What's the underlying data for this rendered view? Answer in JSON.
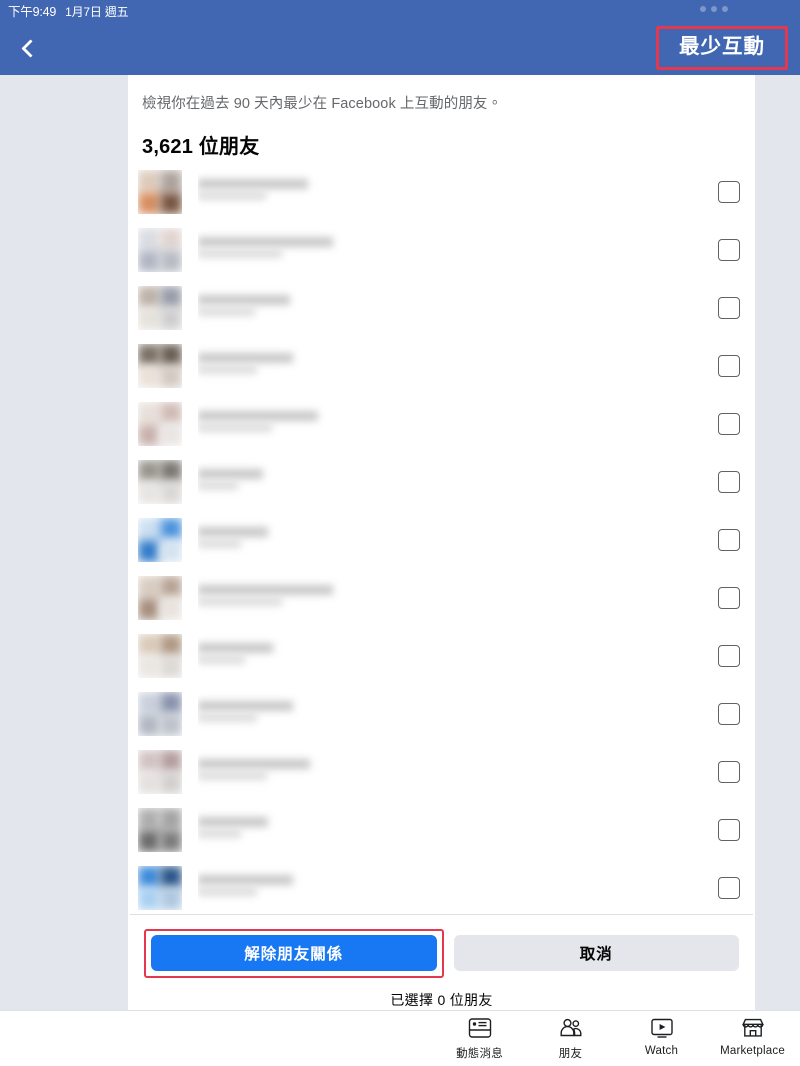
{
  "statusbar": {
    "time": "下午9:49",
    "date": "1月7日 週五",
    "menu_icon": "three-dots-icon"
  },
  "navbar": {
    "back_icon": "chevron-left-icon",
    "title": "最少互動",
    "title_highlight_color": "#e4384f",
    "background_color": "#4267B2"
  },
  "main": {
    "description": "檢視你在過去 90 天內最少在 Facebook 上互動的朋友。",
    "friend_count_label": "3,621 位朋友",
    "friends": [
      {
        "name": "",
        "avatar_colors": [
          "#d8c6b4",
          "#a59a94",
          "#d2824e",
          "#6b4630"
        ],
        "name_width": 110,
        "avatar_blurred": true
      },
      {
        "name": "",
        "avatar_colors": [
          "#d5d8df",
          "#ddd0cb",
          "#a9aebd",
          "#b0b4bd"
        ],
        "name_width": 135,
        "avatar_blurred": true
      },
      {
        "name": "",
        "avatar_colors": [
          "#b7a99f",
          "#8e93a0",
          "#e3ded8",
          "#c9c9c9"
        ],
        "name_width": 92,
        "avatar_blurred": true
      },
      {
        "name": "",
        "avatar_colors": [
          "#6e6256",
          "#5c4f43",
          "#e9ded4",
          "#cfc4bb"
        ],
        "name_width": 95,
        "avatar_blurred": true
      },
      {
        "name": "",
        "avatar_colors": [
          "#e5dcd5",
          "#cbb4ae",
          "#c3a9a4",
          "#e6e2e0"
        ],
        "name_width": 120,
        "avatar_blurred": true
      },
      {
        "name": "",
        "avatar_colors": [
          "#8e8a82",
          "#6e6a63",
          "#e4e2de",
          "#d6d4d1"
        ],
        "name_width": 65,
        "avatar_blurred": true
      },
      {
        "name": "",
        "avatar_colors": [
          "#c6dcef",
          "#3b88d8",
          "#1f6fc4",
          "#cfe0ee"
        ],
        "name_width": 70,
        "avatar_blurred": true
      },
      {
        "name": "",
        "avatar_colors": [
          "#d5c7ba",
          "#b09a8b",
          "#9d8371",
          "#e6e0da"
        ],
        "name_width": 135,
        "avatar_blurred": true
      },
      {
        "name": "",
        "avatar_colors": [
          "#d6c4b2",
          "#a88f79",
          "#e7e3de",
          "#d9d5d0"
        ],
        "name_width": 75,
        "avatar_blurred": true
      },
      {
        "name": "",
        "avatar_colors": [
          "#c4cbd8",
          "#7d88a5",
          "#a9b0bd",
          "#b6bcc6"
        ],
        "name_width": 95,
        "avatar_blurred": true
      },
      {
        "name": "",
        "avatar_colors": [
          "#cdbcbc",
          "#ad9595",
          "#e2dcdc",
          "#cfcaca"
        ],
        "name_width": 112,
        "avatar_blurred": true
      },
      {
        "name": "",
        "avatar_colors": [
          "#a5a5a5",
          "#9a9a9a",
          "#5d5d5d",
          "#6f6f6f"
        ],
        "name_width": 70,
        "avatar_blurred": true
      },
      {
        "name": "",
        "avatar_colors": [
          "#2a7fd6",
          "#16467e",
          "#9fcbf0",
          "#a6c2dd"
        ],
        "name_width": 95,
        "avatar_blurred": true
      }
    ],
    "checkbox_name": "friend-select-checkbox"
  },
  "footer": {
    "primary_button": "解除朋友關係",
    "primary_button_color": "#1877f2",
    "primary_highlight_color": "#e4384f",
    "secondary_button": "取消",
    "selected_note": "已選擇 0 位朋友"
  },
  "tabbar": {
    "items": [
      {
        "label": "動態消息",
        "icon": "news-feed-icon"
      },
      {
        "label": "朋友",
        "icon": "friends-icon"
      },
      {
        "label": "Watch",
        "icon": "watch-play-icon"
      },
      {
        "label": "Marketplace",
        "icon": "marketplace-storefront-icon"
      }
    ]
  }
}
